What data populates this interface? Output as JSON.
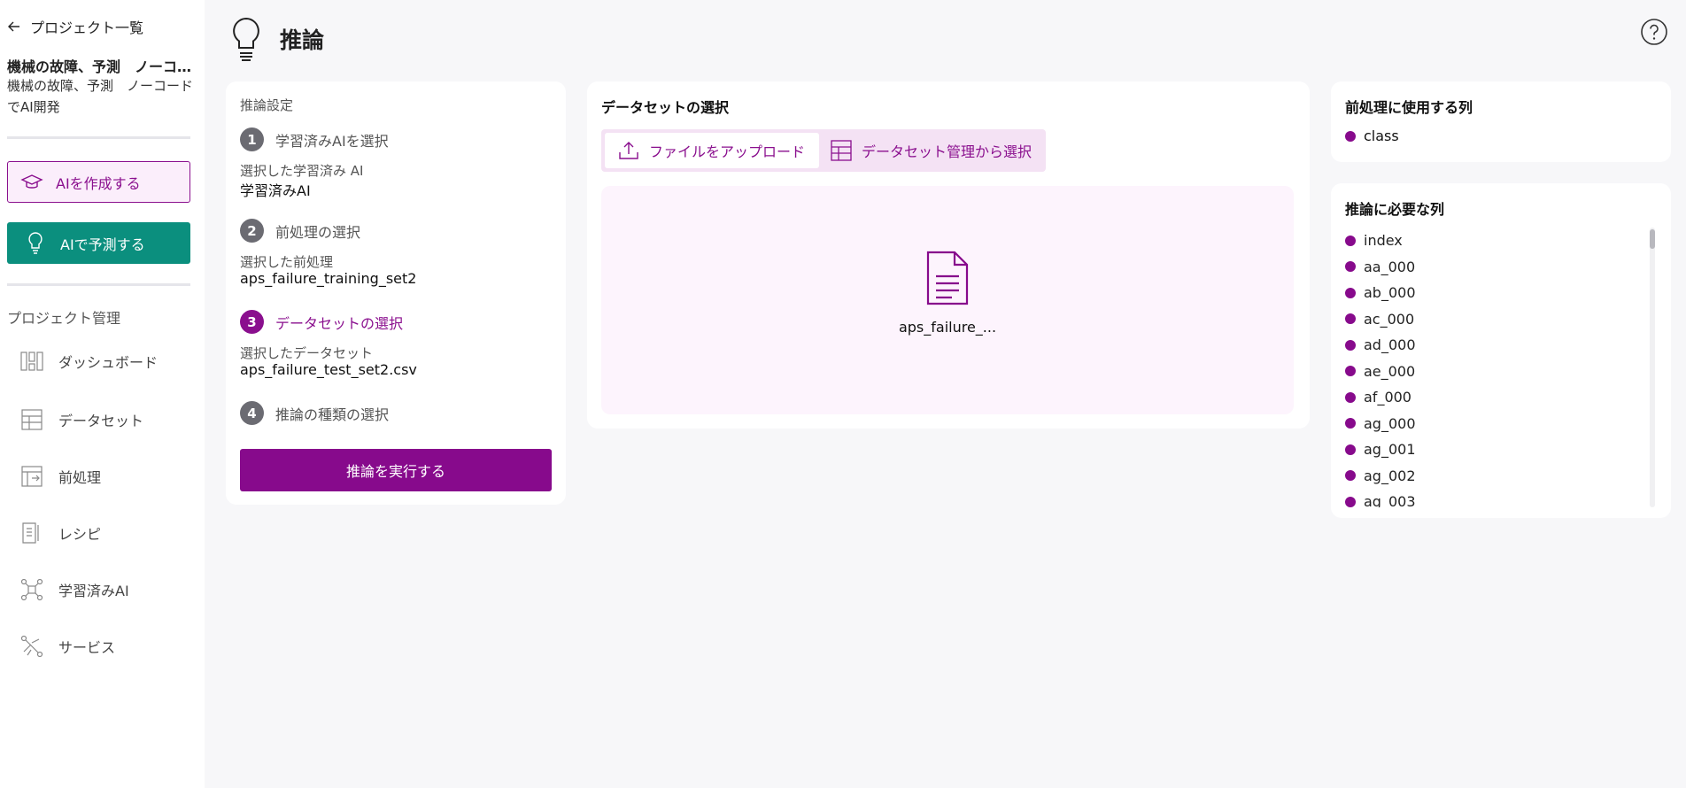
{
  "sidebar": {
    "back_label": "プロジェクト一覧",
    "project_title": "機械の故障、予測　ノーコードでAI開発",
    "project_description": "機械の故障、予測　ノーコードでAI開発",
    "create_ai_label": "AIを作成する",
    "predict_ai_label": "AIで予測する",
    "section_label": "プロジェクト管理",
    "nav": [
      {
        "label": "ダッシュボード",
        "icon": "dashboard-icon"
      },
      {
        "label": "データセット",
        "icon": "dataset-icon"
      },
      {
        "label": "前処理",
        "icon": "preprocess-icon"
      },
      {
        "label": "レシピ",
        "icon": "recipe-icon"
      },
      {
        "label": "学習済みAI",
        "icon": "trained-ai-icon"
      },
      {
        "label": "サービス",
        "icon": "service-icon"
      }
    ]
  },
  "header": {
    "title": "推論",
    "icon": "lightbulb-icon",
    "help_icon": "help-icon"
  },
  "settings": {
    "label": "推論設定",
    "steps": [
      {
        "num": "1",
        "label": "学習済みAIを選択",
        "selected_label": "選択した学習済み AI",
        "selected_value": "学習済みAI"
      },
      {
        "num": "2",
        "label": "前処理の選択",
        "selected_label": "選択した前処理",
        "selected_value": "aps_failure_training_set2"
      },
      {
        "num": "3",
        "label": "データセットの選択",
        "selected_label": "選択したデータセット",
        "selected_value": "aps_failure_test_set2.csv"
      },
      {
        "num": "4",
        "label": "推論の種類の選択"
      }
    ],
    "run_label": "推論を実行する"
  },
  "dataset": {
    "title": "データセットの選択",
    "tab_upload": "ファイルをアップロード",
    "tab_manage": "データセット管理から選択",
    "file_name": "aps_failure_..."
  },
  "preprocess_columns": {
    "title": "前処理に使用する列",
    "items": [
      "class"
    ]
  },
  "inference_columns": {
    "title": "推論に必要な列",
    "items": [
      "index",
      "aa_000",
      "ab_000",
      "ac_000",
      "ad_000",
      "ae_000",
      "af_000",
      "ag_000",
      "ag_001",
      "ag_002",
      "ag_003"
    ]
  },
  "colors": {
    "accent": "#870a8c",
    "teal": "#0b8f7e"
  }
}
